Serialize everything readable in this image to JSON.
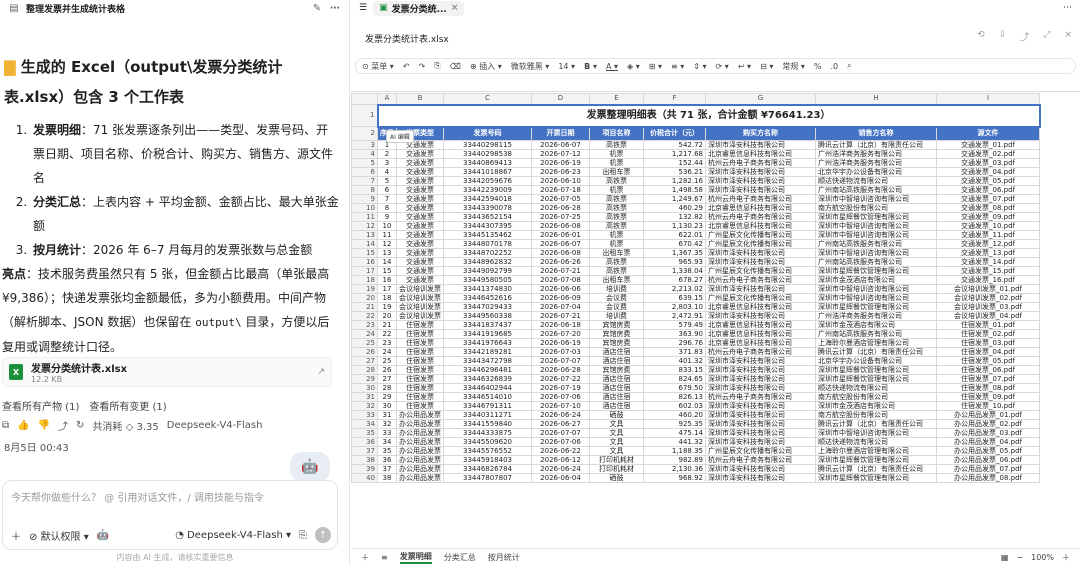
{
  "left": {
    "window_title": "整理发票并生成统计表格",
    "section_title": "生成的 Excel（output\\发票分类统计表.xlsx）包含 3 个工作表",
    "items": [
      {
        "bold": "发票明细",
        "text": "：71 张发票逐条列出——类型、发票号码、开票日期、项目名称、价税合计、购买方、销售方、源文件名"
      },
      {
        "bold": "分类汇总",
        "text": "：上表内容 + 平均金额、金额占比、最大单张金额"
      },
      {
        "bold": "按月统计",
        "text": "：2026 年 6–7 月每月的发票张数与总金额"
      }
    ],
    "highlight_label": "亮点",
    "highlight_text": "：技术服务费虽然只有 5 张，但金额占比最高（单张最高 ¥9,386）；快递发票张均金额最低，多为小额费用。中间产物（解析脚本、JSON 数据）也保留在",
    "highlight_code": "output\\",
    "highlight_tail": "目录，方便以后复用或调整统计口径。",
    "file_name": "发票分类统计表.xlsx",
    "file_size": "12.2 KB",
    "link_all": "查看所有产物 (1)",
    "link_changes": "查看所有变更 (1)",
    "consume": "共消耗 ◇ 3.35",
    "model_tag": "Deepseek-V4-Flash",
    "date": "8月5日 00:43",
    "input_placeholder": "今天帮你做些什么？ @ 引用对话文件，/ 调用技能与指令",
    "perm": "默认权限",
    "model_select": "Deepseek-V4-Flash",
    "disclaimer": "内容由 AI 生成，请核实重要信息"
  },
  "right": {
    "tab_title": "发票分类统...",
    "file_name": "发票分类统计表.xlsx",
    "toolbar": [
      "菜单",
      "插入",
      "微软雅黑",
      "14",
      "B",
      "A",
      "常规",
      "%"
    ],
    "sheet_title": "发票整理明细表（共 71 张，合计金额 ¥76641.23）",
    "ai_badge": "AI 编辑",
    "columns": [
      "A",
      "B",
      "C",
      "D",
      "E",
      "F",
      "G",
      "H",
      "I"
    ],
    "headers": [
      "序号",
      "发票类型",
      "发票号码",
      "开票日期",
      "项目名称",
      "价税合计（元）",
      "购买方名称",
      "销售方名称",
      "源文件"
    ],
    "rows": [
      [
        "1",
        "交通发票",
        "33440298115",
        "2026-06-07",
        "高铁票",
        "542.72",
        "深圳市泽安科技有限公司",
        "腾讯云计算（北京）有限责任公司",
        "交通发票_01.pdf"
      ],
      [
        "2",
        "交通发票",
        "33440298538",
        "2026-07-12",
        "机票",
        "1,217.68",
        "北京睿思信息科技有限公司",
        "广州浩洋商务服务有限公司",
        "交通发票_02.pdf"
      ],
      [
        "3",
        "交通发票",
        "33440869413",
        "2026-06-19",
        "机票",
        "152.44",
        "杭州云舟电子商务有限公司",
        "广州浩洋商务服务有限公司",
        "交通发票_03.pdf"
      ],
      [
        "4",
        "交通发票",
        "33441018867",
        "2026-06-23",
        "出租车票",
        "536.21",
        "深圳市泽安科技有限公司",
        "北京华宇办公设备有限公司",
        "交通发票_04.pdf"
      ],
      [
        "5",
        "交通发票",
        "33442059676",
        "2026-06-10",
        "高铁票",
        "1,282.16",
        "深圳市泽安科技有限公司",
        "顺达快递物流有限公司",
        "交通发票_05.pdf"
      ],
      [
        "6",
        "交通发票",
        "33442239009",
        "2026-07-18",
        "机票",
        "1,498.58",
        "深圳市泽安科技有限公司",
        "广州南站高铁服务有限公司",
        "交通发票_06.pdf"
      ],
      [
        "7",
        "交通发票",
        "33442594018",
        "2026-07-05",
        "高铁票",
        "1,249.67",
        "杭州云舟电子商务有限公司",
        "深圳市中智培训咨询有限公司",
        "交通发票_07.pdf"
      ],
      [
        "8",
        "交通发票",
        "33443390078",
        "2026-06-28",
        "高铁票",
        "460.29",
        "北京睿思信息科技有限公司",
        "南方航空股份有限公司",
        "交通发票_08.pdf"
      ],
      [
        "9",
        "交通发票",
        "33443652154",
        "2026-07-25",
        "高铁票",
        "132.82",
        "杭州云舟电子商务有限公司",
        "深圳市星辉餐饮管理有限公司",
        "交通发票_09.pdf"
      ],
      [
        "10",
        "交通发票",
        "33444307395",
        "2026-06-08",
        "高铁票",
        "1,130.23",
        "北京睿思信息科技有限公司",
        "深圳市中智培训咨询有限公司",
        "交通发票_10.pdf"
      ],
      [
        "11",
        "交通发票",
        "33445135462",
        "2026-06-01",
        "机票",
        "622.01",
        "广州星辰文化传播有限公司",
        "深圳市中智培训咨询有限公司",
        "交通发票_11.pdf"
      ],
      [
        "12",
        "交通发票",
        "33448070178",
        "2026-06-07",
        "机票",
        "670.42",
        "广州星辰文化传播有限公司",
        "广州南站高铁服务有限公司",
        "交通发票_12.pdf"
      ],
      [
        "13",
        "交通发票",
        "33448702252",
        "2026-06-08",
        "出租车票",
        "1,367.35",
        "深圳市泽安科技有限公司",
        "深圳市中智培训咨询有限公司",
        "交通发票_13.pdf"
      ],
      [
        "14",
        "交通发票",
        "33448962832",
        "2026-06-26",
        "高铁票",
        "965.93",
        "深圳市泽安科技有限公司",
        "广州南站高铁服务有限公司",
        "交通发票_14.pdf"
      ],
      [
        "15",
        "交通发票",
        "33449092799",
        "2026-07-21",
        "高铁票",
        "1,338.04",
        "广州星辰文化传播有限公司",
        "深圳市星辉餐饮管理有限公司",
        "交通发票_15.pdf"
      ],
      [
        "16",
        "交通发票",
        "33449580505",
        "2026-07-08",
        "出租车票",
        "678.27",
        "杭州云舟电子商务有限公司",
        "深圳市金茂酒店有限公司",
        "交通发票_16.pdf"
      ],
      [
        "17",
        "会议培训发票",
        "33441374830",
        "2026-06-06",
        "培训费",
        "2,213.02",
        "深圳市泽安科技有限公司",
        "深圳市中智培训咨询有限公司",
        "会议培训发票_01.pdf"
      ],
      [
        "18",
        "会议培训发票",
        "33446452616",
        "2026-06-09",
        "会议费",
        "639.15",
        "广州星辰文化传播有限公司",
        "深圳市中智培训咨询有限公司",
        "会议培训发票_02.pdf"
      ],
      [
        "19",
        "会议培训发票",
        "33447029433",
        "2026-07-04",
        "会议费",
        "2,803.10",
        "北京睿思信息科技有限公司",
        "深圳市星辉餐饮管理有限公司",
        "会议培训发票_03.pdf"
      ],
      [
        "20",
        "会议培训发票",
        "33449560338",
        "2026-07-21",
        "培训费",
        "2,472.91",
        "深圳市泽安科技有限公司",
        "广州浩洋商务服务有限公司",
        "会议培训发票_04.pdf"
      ],
      [
        "21",
        "住宿发票",
        "33441837437",
        "2026-06-18",
        "宾馆房费",
        "579.49",
        "北京睿思信息科技有限公司",
        "深圳市金茂酒店有限公司",
        "住宿发票_01.pdf"
      ],
      [
        "22",
        "住宿发票",
        "33441919685",
        "2026-07-20",
        "宾馆房费",
        "363.90",
        "北京睿思信息科技有限公司",
        "广州南站高铁服务有限公司",
        "住宿发票_02.pdf"
      ],
      [
        "23",
        "住宿发票",
        "33441976643",
        "2026-06-19",
        "宾馆房费",
        "296.76",
        "北京睿思信息科技有限公司",
        "上海聆尔曼酒店管理有限公司",
        "住宿发票_03.pdf"
      ],
      [
        "24",
        "住宿发票",
        "33442189281",
        "2026-07-03",
        "酒店住宿",
        "371.83",
        "杭州云舟电子商务有限公司",
        "腾讯云计算（北京）有限责任公司",
        "住宿发票_04.pdf"
      ],
      [
        "25",
        "住宿发票",
        "33443472798",
        "2026-07-07",
        "酒店住宿",
        "401.32",
        "深圳市泽安科技有限公司",
        "北京华宇办公设备有限公司",
        "住宿发票_05.pdf"
      ],
      [
        "26",
        "住宿发票",
        "33446296481",
        "2026-06-28",
        "宾馆房费",
        "833.15",
        "深圳市泽安科技有限公司",
        "深圳市星辉餐饮管理有限公司",
        "住宿发票_06.pdf"
      ],
      [
        "27",
        "住宿发票",
        "33446326839",
        "2026-07-22",
        "酒店住宿",
        "824.65",
        "深圳市泽安科技有限公司",
        "深圳市星辉餐饮管理有限公司",
        "住宿发票_07.pdf"
      ],
      [
        "28",
        "住宿发票",
        "33446402944",
        "2026-07-19",
        "酒店住宿",
        "679.50",
        "深圳市泽安科技有限公司",
        "顺达快递物流有限公司",
        "住宿发票_08.pdf"
      ],
      [
        "29",
        "住宿发票",
        "33446514010",
        "2026-07-06",
        "酒店住宿",
        "826.13",
        "杭州云舟电子商务有限公司",
        "南方航空股份有限公司",
        "住宿发票_09.pdf"
      ],
      [
        "30",
        "住宿发票",
        "33446791311",
        "2026-07-10",
        "酒店住宿",
        "602.03",
        "深圳市泽安科技有限公司",
        "深圳市金茂酒店有限公司",
        "住宿发票_10.pdf"
      ],
      [
        "31",
        "办公用品发票",
        "33440311271",
        "2026-06-24",
        "硒鼓",
        "460.20",
        "深圳市泽安科技有限公司",
        "南方航空股份有限公司",
        "办公用品发票_01.pdf"
      ],
      [
        "32",
        "办公用品发票",
        "33441559840",
        "2026-06-27",
        "文具",
        "925.35",
        "深圳市泽安科技有限公司",
        "腾讯云计算（北京）有限责任公司",
        "办公用品发票_02.pdf"
      ],
      [
        "33",
        "办公用品发票",
        "33444333875",
        "2026-07-07",
        "文具",
        "475.14",
        "深圳市泽安科技有限公司",
        "深圳市中智培训咨询有限公司",
        "办公用品发票_03.pdf"
      ],
      [
        "34",
        "办公用品发票",
        "33445509620",
        "2026-07-06",
        "文具",
        "441.32",
        "深圳市泽安科技有限公司",
        "顺达快递物流有限公司",
        "办公用品发票_04.pdf"
      ],
      [
        "35",
        "办公用品发票",
        "33445576552",
        "2026-06-22",
        "文具",
        "1,188.35",
        "广州星辰文化传播有限公司",
        "上海聆尔曼酒店管理有限公司",
        "办公用品发票_05.pdf"
      ],
      [
        "36",
        "办公用品发票",
        "33445918403",
        "2026-06-12",
        "打印机耗材",
        "982.89",
        "杭州云舟电子商务有限公司",
        "深圳市星辉餐饮管理有限公司",
        "办公用品发票_06.pdf"
      ],
      [
        "37",
        "办公用品发票",
        "33446826784",
        "2026-06-24",
        "打印机耗材",
        "2,130.36",
        "深圳市泽安科技有限公司",
        "腾讯云计算（北京）有限责任公司",
        "办公用品发票_07.pdf"
      ],
      [
        "38",
        "办公用品发票",
        "33447807807",
        "2026-06-04",
        "硒鼓",
        "968.92",
        "深圳市泽安科技有限公司",
        "深圳市星辉餐饮管理有限公司",
        "办公用品发票_08.pdf"
      ]
    ],
    "sheet_tabs": [
      "发票明细",
      "分类汇总",
      "按月统计"
    ],
    "zoom": "100%"
  }
}
